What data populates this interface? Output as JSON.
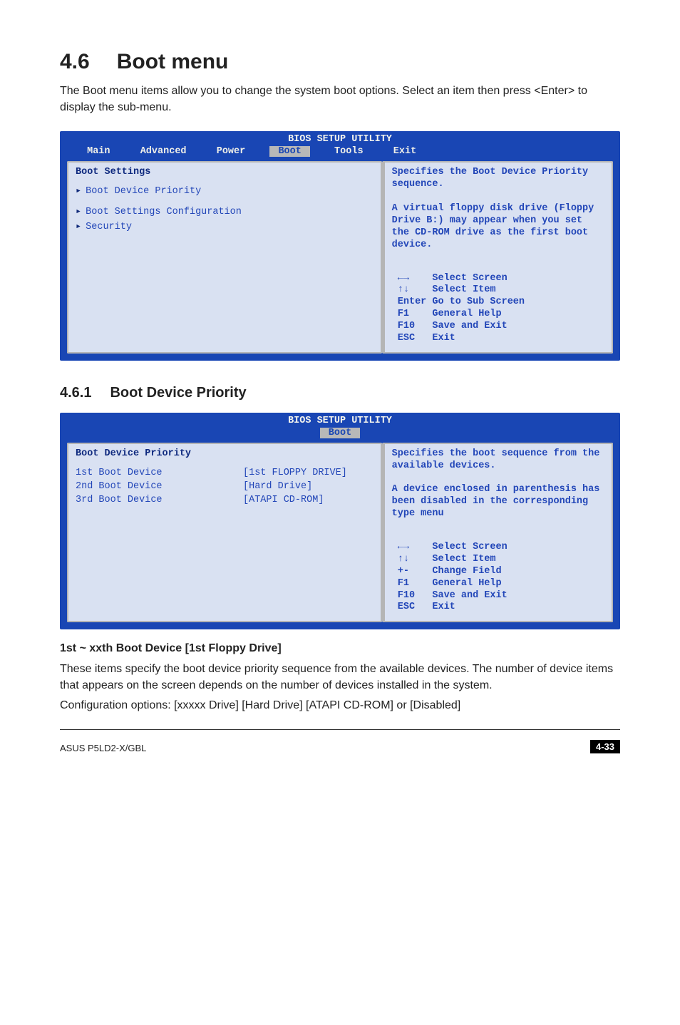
{
  "section": {
    "number": "4.6",
    "title": "Boot menu",
    "intro": "The Boot menu items allow you to change the system boot options. Select an item then press <Enter> to display the sub-menu."
  },
  "subsection": {
    "number": "4.6.1",
    "title": "Boot Device Priority"
  },
  "field_heading": "1st ~ xxth Boot Device [1st Floppy Drive]",
  "field_text1": "These items specify the boot device priority sequence from the available devices. The number of device items that appears on the screen depends on the number of devices installed in the system.",
  "field_text2": "Configuration options: [xxxxx Drive] [Hard Drive] [ATAPI CD-ROM] or [Disabled]",
  "bios1": {
    "titlebar": "BIOS SETUP UTILITY",
    "tabs": {
      "main": " Main ",
      "advanced": " Advanced ",
      "power": " Power ",
      "boot": " Boot ",
      "tools": " Tools ",
      "exit": " Exit "
    },
    "left": {
      "heading": "Boot Settings",
      "items": [
        "Boot Device Priority",
        "",
        "Boot Settings Configuration",
        "Security"
      ],
      "selected_index": 0
    },
    "right": {
      "help": "Specifies the  Boot Device Priority sequence.\n\nA virtual floppy disk drive (Floppy Drive B:) may appear when you set the CD-ROM drive as the first boot device.",
      "nav": " ←→    Select Screen\n ↑↓    Select Item\n Enter Go to Sub Screen\n F1    General Help\n F10   Save and Exit\n ESC   Exit"
    }
  },
  "bios2": {
    "titlebar": "BIOS SETUP UTILITY",
    "tab_boot": " Boot ",
    "left": {
      "heading": "Boot Device Priority",
      "rows": [
        {
          "label": "1st Boot Device",
          "value": "[1st FLOPPY DRIVE]"
        },
        {
          "label": "2nd Boot Device",
          "value": "[Hard Drive]"
        },
        {
          "label": "3rd Boot Device",
          "value": "[ATAPI CD-ROM]"
        }
      ]
    },
    "right": {
      "help": "Specifies the boot sequence from the available devices.\n\nA device enclosed in parenthesis has been disabled in the corresponding type menu",
      "nav": " ←→    Select Screen\n ↑↓    Select Item\n +-    Change Field\n F1    General Help\n F10   Save and Exit\n ESC   Exit"
    }
  },
  "footer": {
    "left": "ASUS P5LD2-X/GBL",
    "right": "4-33"
  }
}
